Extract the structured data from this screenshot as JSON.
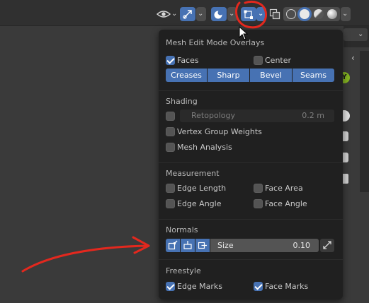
{
  "header": {
    "icons": [
      "eye-icon",
      "transform-gizmo-icon",
      "overlay-sphere-icon",
      "mesh-edit-overlay-icon",
      "xray-icon",
      "shading-wireframe-icon",
      "shading-solid-icon",
      "shading-material-icon",
      "shading-rendered-icon"
    ]
  },
  "popover": {
    "title": "Mesh Edit Mode Overlays",
    "faces_label": "Faces",
    "faces_checked": true,
    "center_label": "Center",
    "center_checked": false,
    "edge_tabs": [
      "Creases",
      "Sharp",
      "Bevel",
      "Seams"
    ],
    "shading": {
      "title": "Shading",
      "retopology_label": "Retopology",
      "retopology_value": "0.2 m",
      "retopology_checked": false,
      "vertex_group_weights_label": "Vertex Group Weights",
      "mesh_analysis_label": "Mesh Analysis"
    },
    "measurement": {
      "title": "Measurement",
      "edge_length_label": "Edge Length",
      "face_area_label": "Face Area",
      "edge_angle_label": "Edge Angle",
      "face_angle_label": "Face Angle"
    },
    "normals": {
      "title": "Normals",
      "size_label": "Size",
      "size_value": "0.10"
    },
    "freestyle": {
      "title": "Freestyle",
      "edge_marks_label": "Edge Marks",
      "edge_marks_checked": true,
      "face_marks_label": "Face Marks",
      "face_marks_checked": true
    }
  },
  "side_toolbar": {
    "axis_label": "Y"
  },
  "colors": {
    "accent": "#4772b3",
    "panel_bg": "#202020",
    "annotation_red": "#e3281e"
  }
}
